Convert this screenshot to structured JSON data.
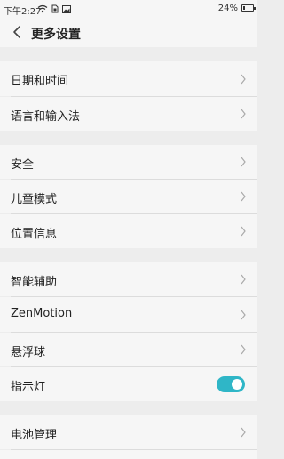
{
  "status_bar": {
    "time": "下午2:27",
    "battery_text": "24%",
    "battery_level": 0.24
  },
  "header": {
    "title": "更多设置"
  },
  "groups": [
    {
      "items": [
        {
          "label": "日期和时间"
        },
        {
          "label": "语言和输入法"
        }
      ]
    },
    {
      "items": [
        {
          "label": "安全"
        },
        {
          "label": "儿童模式"
        },
        {
          "label": "位置信息"
        }
      ]
    },
    {
      "items": [
        {
          "label": "智能辅助"
        },
        {
          "label": "ZenMotion"
        },
        {
          "label": "悬浮球"
        },
        {
          "label": "指示灯"
        }
      ]
    },
    {
      "items": [
        {
          "label": "电池管理"
        }
      ]
    }
  ],
  "indicator_light_toggle": {
    "on": true
  },
  "colors": {
    "accent": "#2fb6c7",
    "background": "#ededed",
    "surface": "#f6f6f6"
  }
}
